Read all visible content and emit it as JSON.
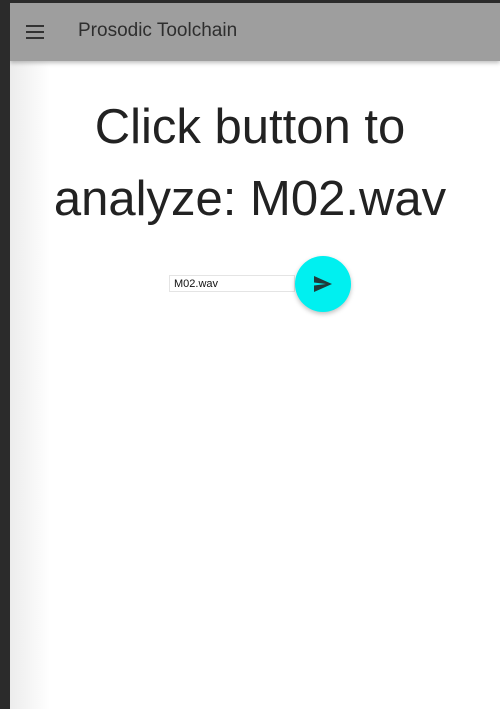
{
  "appbar": {
    "title": "Prosodic Toolchain",
    "menu_icon": "hamburger-menu-icon",
    "background": "#9e9e9e"
  },
  "main": {
    "headline_line1": "Click button to",
    "headline_line2": "analyze: M02.wav",
    "file_input_value": "M02.wav",
    "analyze_button_icon": "send-arrow-icon",
    "accent": "#00f0f0"
  }
}
